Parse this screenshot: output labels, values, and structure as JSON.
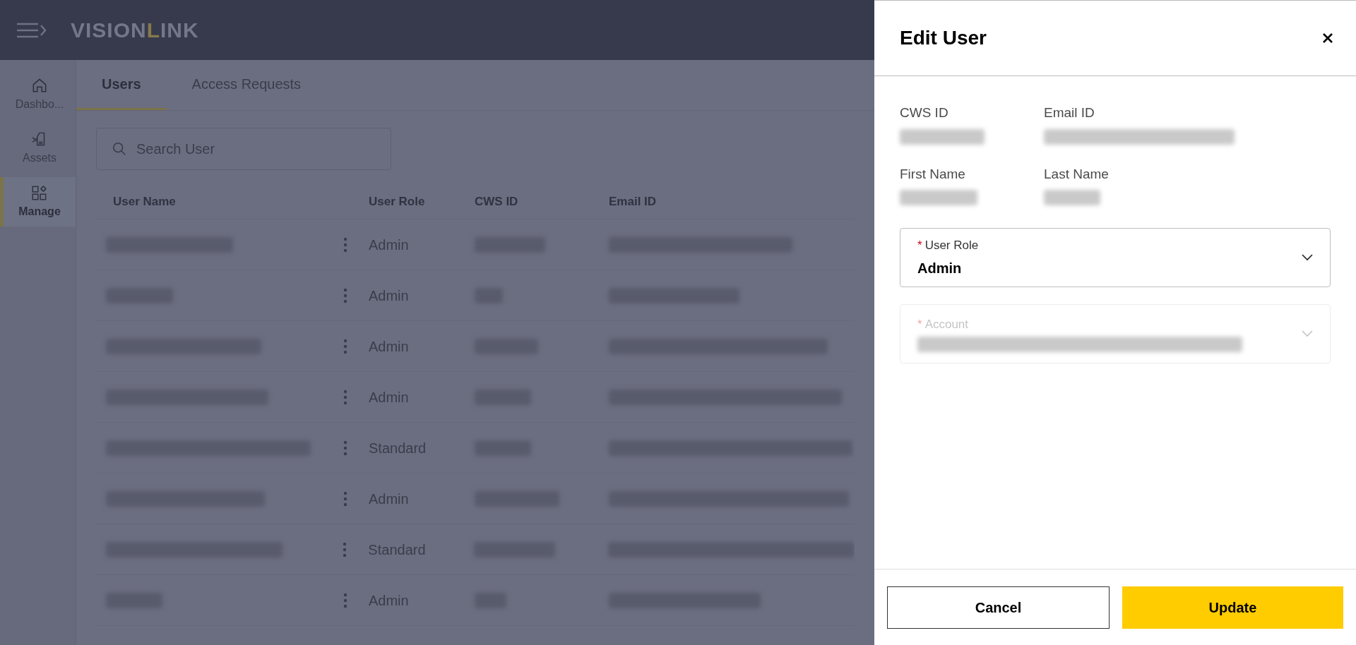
{
  "header": {
    "logo": {
      "prefix": "VISION",
      "highlight": "L",
      "suffix": "INK"
    }
  },
  "sidebar": {
    "items": [
      {
        "label": "Dashbo...",
        "selected": false
      },
      {
        "label": "Assets",
        "selected": false
      },
      {
        "label": "Manage",
        "selected": true
      }
    ]
  },
  "tabs": [
    {
      "label": "Users",
      "selected": true
    },
    {
      "label": "Access Requests",
      "selected": false
    }
  ],
  "search": {
    "placeholder": "Search User"
  },
  "table": {
    "columns": [
      "User Name",
      "User Role",
      "CWS ID",
      "Email ID"
    ],
    "rows": [
      {
        "role": "Admin"
      },
      {
        "role": "Admin"
      },
      {
        "role": "Admin"
      },
      {
        "role": "Admin"
      },
      {
        "role": "Standard"
      },
      {
        "role": "Admin"
      },
      {
        "role": "Standard"
      },
      {
        "role": "Admin"
      }
    ]
  },
  "panel": {
    "title": "Edit User",
    "info": [
      {
        "label": "CWS ID"
      },
      {
        "label": "Email ID"
      },
      {
        "label": "First Name"
      },
      {
        "label": "Last Name"
      }
    ],
    "fields": [
      {
        "label": "User Role",
        "required_mark": "*",
        "value": "Admin",
        "disabled": false
      },
      {
        "label": "Account",
        "required_mark": "*",
        "disabled": true
      }
    ],
    "buttons": [
      {
        "label": "Cancel",
        "kind": "secondary"
      },
      {
        "label": "Update",
        "kind": "primary"
      }
    ]
  }
}
